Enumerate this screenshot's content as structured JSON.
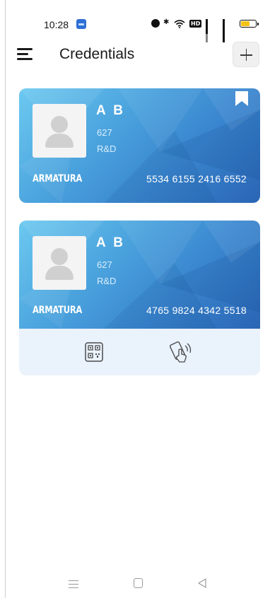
{
  "status_bar": {
    "time": "10:28",
    "icons": [
      "app-notification-icon",
      "alarm-icon",
      "bluetooth-icon",
      "wifi-icon",
      "hd-icon",
      "signal-4g-icon",
      "signal-5g-icon",
      "battery-icon"
    ],
    "hd_label": "HD",
    "battery_color": "#f3c316"
  },
  "header": {
    "title": "Credentials",
    "menu_icon": "hamburger-menu-icon",
    "add_icon": "plus-icon"
  },
  "cards": [
    {
      "name": "A B",
      "id": "627",
      "department": "R&D",
      "brand": "ARMATURA",
      "number": "5534 6155 2416 6552",
      "bookmarked": true
    },
    {
      "name": "A B",
      "id": "627",
      "department": "R&D",
      "brand": "ARMATURA",
      "number": "4765 9824 4342 5518",
      "bookmarked": false,
      "actions": [
        "qr-code-icon",
        "nfc-tap-icon"
      ]
    }
  ],
  "nav_bar": {
    "icons": [
      "recents-menu-icon",
      "home-square-icon",
      "back-triangle-icon"
    ]
  },
  "colors": {
    "card_gradient_start": "#6cc9f0",
    "card_gradient_end": "#2a65b4",
    "actions_background": "#eaf2fc"
  }
}
